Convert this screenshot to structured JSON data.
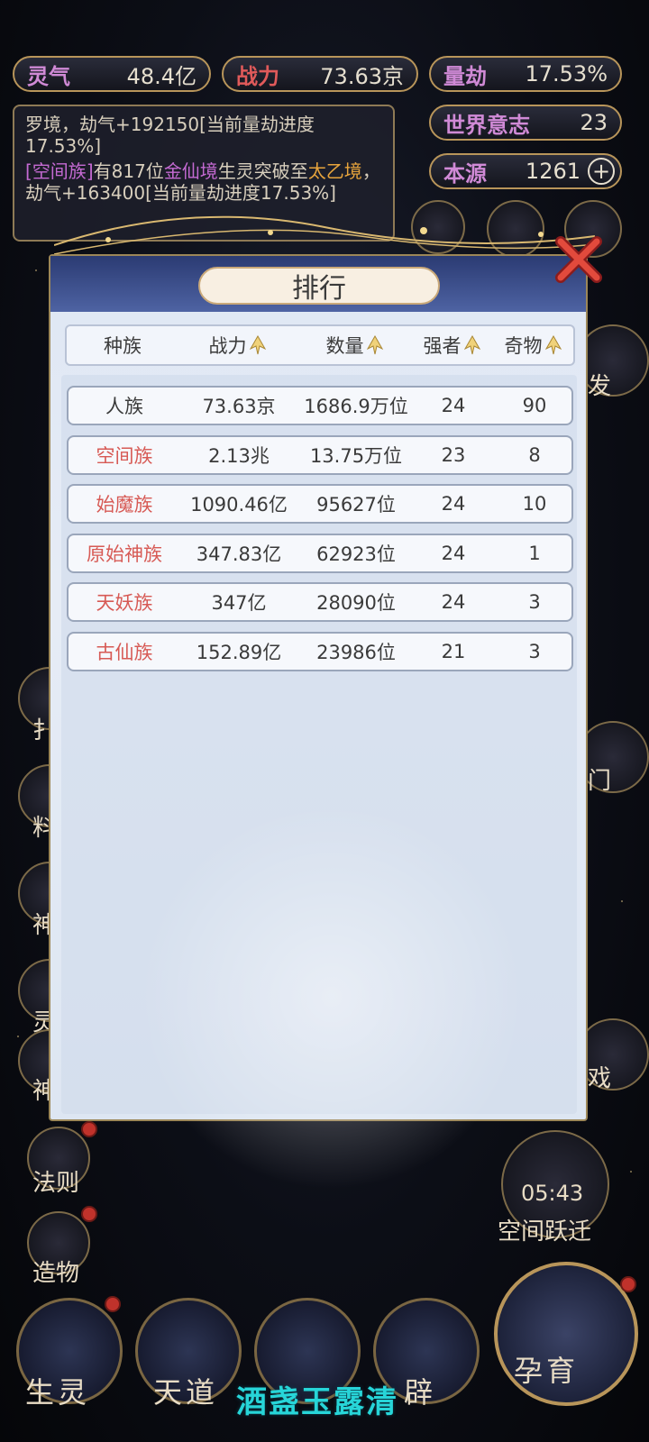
{
  "stats": {
    "lingqi": {
      "label": "灵气",
      "value": "48.4亿"
    },
    "zhanli": {
      "label": "战力",
      "value": "73.63京"
    },
    "liangjie": {
      "label": "量劫",
      "value": "17.53%"
    },
    "world_will": {
      "label": "世界意志",
      "value": "23"
    },
    "benyuan": {
      "label": "本源",
      "value": "1261",
      "plus": "+"
    }
  },
  "log": {
    "line1": "罗境，劫气+192150[当前量劫进度17.53%]",
    "line2": {
      "bracket_open": "[",
      "race": "空间族",
      "bracket_close": "]",
      "t1": "有817位",
      "realm1": "金仙境",
      "t2": "生灵突破至",
      "realm2": "太乙境",
      "t3": "，劫气+163400[当前量劫进度17.53%]"
    }
  },
  "modal": {
    "title": "排行",
    "columns": [
      "种族",
      "战力",
      "数量",
      "强者",
      "奇物"
    ],
    "rows": [
      {
        "race": "人族",
        "power": "73.63京",
        "count": "1686.9万位",
        "strong": "24",
        "items": "90",
        "highlight": false
      },
      {
        "race": "空间族",
        "power": "2.13兆",
        "count": "13.75万位",
        "strong": "23",
        "items": "8",
        "highlight": true
      },
      {
        "race": "始魔族",
        "power": "1090.46亿",
        "count": "95627位",
        "strong": "24",
        "items": "10",
        "highlight": true
      },
      {
        "race": "原始神族",
        "power": "347.83亿",
        "count": "62923位",
        "strong": "24",
        "items": "1",
        "highlight": true
      },
      {
        "race": "天妖族",
        "power": "347亿",
        "count": "28090位",
        "strong": "24",
        "items": "3",
        "highlight": true
      },
      {
        "race": "古仙族",
        "power": "152.89亿",
        "count": "23986位",
        "strong": "21",
        "items": "3",
        "highlight": true
      }
    ]
  },
  "side": {
    "right_partial_1": "发",
    "right_partial_2": "门",
    "right_partial_3": "戏",
    "left_partial": [
      "扌",
      "料",
      "神",
      "灵",
      "神"
    ],
    "fa_ze": "法则",
    "zao_wu": "造物",
    "timer": "05:43",
    "space_jump": "空间跃迁"
  },
  "bottom": {
    "sheng_ling": "生灵",
    "tian_dao": "天道",
    "kai_pi": "辟",
    "yun_yu": "孕育",
    "watermark": "酒盏玉露清"
  },
  "colors": {
    "accent_gold": "#b8955a",
    "race_red": "#d75a55",
    "watermark": "#27d5d8"
  }
}
